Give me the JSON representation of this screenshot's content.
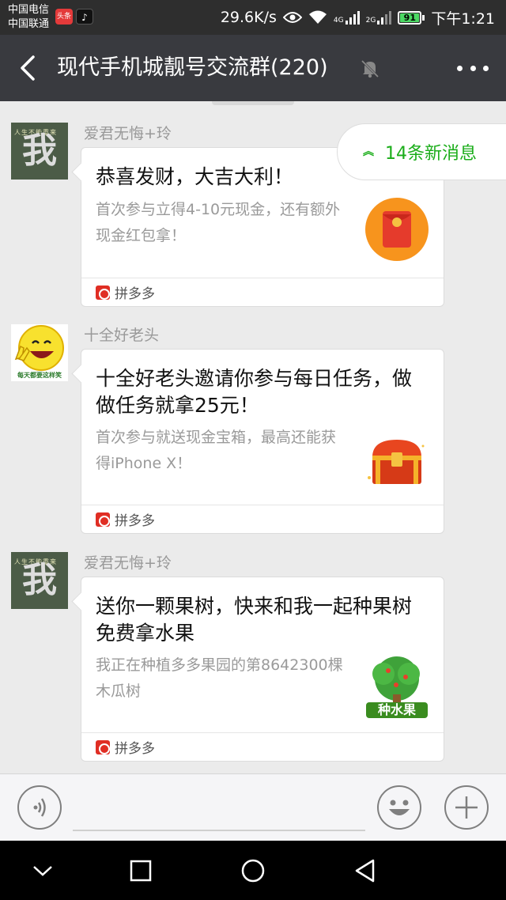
{
  "status_bar": {
    "carrier_1": "中国电信",
    "carrier_2": "中国联通",
    "toutiao_label": "头条",
    "douyin_label": "♪",
    "net_speed": "29.6K/s",
    "net_4g": "4G",
    "net_2g": "2G",
    "battery_level": "91",
    "time": "下午1:21"
  },
  "nav": {
    "title": "现代手机城靓号交流群(220)"
  },
  "new_messages_label": "14条新消息",
  "messages": [
    {
      "sender": "爱君无悔+玲",
      "avatar_glyph": "我",
      "avatar_fine": "人生不能重来",
      "title": "恭喜发财，大吉大利！",
      "desc": "首次参与立得4-10元现金，还有额外现金红包拿！",
      "thumb": "red-envelope",
      "footer": "拼多多"
    },
    {
      "sender": "十全好老头",
      "avatar_caption": "每天都要这样笑",
      "title": "十全好老头邀请你参与每日任务，做做任务就拿25元！",
      "desc": "首次参与就送现金宝箱，最高还能获得iPhone X！",
      "thumb": "treasure-chest",
      "footer": "拼多多"
    },
    {
      "sender": "爱君无悔+玲",
      "avatar_glyph": "我",
      "avatar_fine": "人生不能重来",
      "title": "送你一颗果树，快来和我一起种果树免费拿水果",
      "desc": "我正在种植多多果园的第8642300棵木瓜树",
      "thumb": "fruit-tree",
      "thumb_label": "种水果",
      "footer": "拼多多"
    }
  ],
  "colors": {
    "nav_bg": "#393a3f",
    "chat_bg": "#ebebeb",
    "accent_green": "#1aad19",
    "pdd_red": "#e02e24"
  }
}
